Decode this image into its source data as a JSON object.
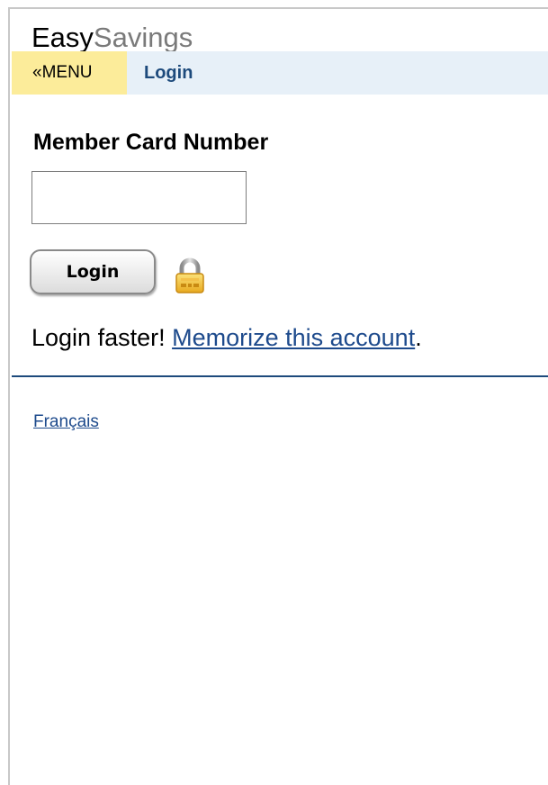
{
  "brand": {
    "part_a": "Easy",
    "part_b": "Savings"
  },
  "nav": {
    "menu_label": "«MENU",
    "current": "Login"
  },
  "form": {
    "card_label": "Member Card Number",
    "card_value": "",
    "login_label": "Login"
  },
  "promo": {
    "prefix": "Login faster! ",
    "link": "Memorize this account",
    "suffix": "."
  },
  "footer": {
    "language_link": "Français"
  },
  "colors": {
    "menu_bg": "#fcec9a",
    "nav_bg": "#e7f0f8",
    "link": "#1d4a8c",
    "divider": "#1d4a7c"
  },
  "icons": {
    "lock": "lock-icon"
  }
}
